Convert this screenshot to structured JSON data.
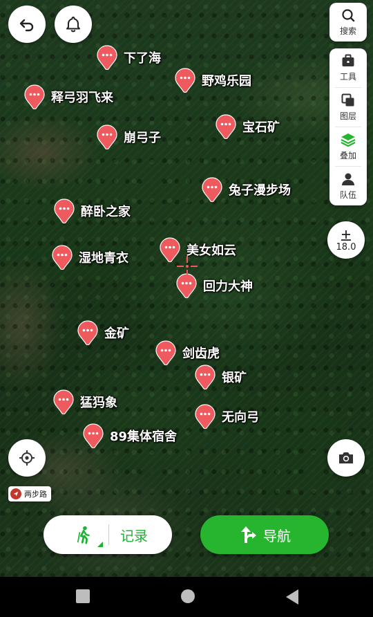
{
  "map": {
    "pois": [
      {
        "id": "xialehai",
        "label": "下了海"
      },
      {
        "id": "yejileyuan",
        "label": "野鸡乐园"
      },
      {
        "id": "shigongyufeilai",
        "label": "释弓羽飞来"
      },
      {
        "id": "benggongzi",
        "label": "崩弓子"
      },
      {
        "id": "baoshikuang",
        "label": "宝石矿"
      },
      {
        "id": "tuzimanbuchang",
        "label": "兔子漫步场"
      },
      {
        "id": "zuiwozhijia",
        "label": "醉卧之家"
      },
      {
        "id": "meinvruyun",
        "label": "美女如云"
      },
      {
        "id": "shidiqingyi",
        "label": "湿地青衣"
      },
      {
        "id": "hulidashen",
        "label": "回力大神"
      },
      {
        "id": "jinkuang",
        "label": "金矿"
      },
      {
        "id": "jianchihu",
        "label": "剑齿虎"
      },
      {
        "id": "yinkuang",
        "label": "银矿"
      },
      {
        "id": "mengmaxiang",
        "label": "猛犸象"
      },
      {
        "id": "wuxianggong",
        "label": "无向弓"
      },
      {
        "id": "sushe89",
        "label": "89集体宿舍"
      }
    ]
  },
  "toolbar": {
    "search_label": "搜索",
    "tools_label": "工具",
    "layers_label": "图层",
    "overlay_label": "叠加",
    "team_label": "队伍"
  },
  "zoom": {
    "level": "18.0"
  },
  "route_tag": {
    "label": "两步路"
  },
  "actions": {
    "record_label": "记录",
    "navigate_label": "导航"
  },
  "colors": {
    "pin": "#f05a5f",
    "accent_green": "#27b52f",
    "record_green": "#1db233"
  },
  "icons": [
    "back-icon",
    "bell-icon",
    "search-icon",
    "toolbox-icon",
    "layers-icon",
    "overlay-icon",
    "team-icon",
    "zoom-icon",
    "locate-icon",
    "camera-icon",
    "walker-icon",
    "navigate-arrow-icon"
  ]
}
